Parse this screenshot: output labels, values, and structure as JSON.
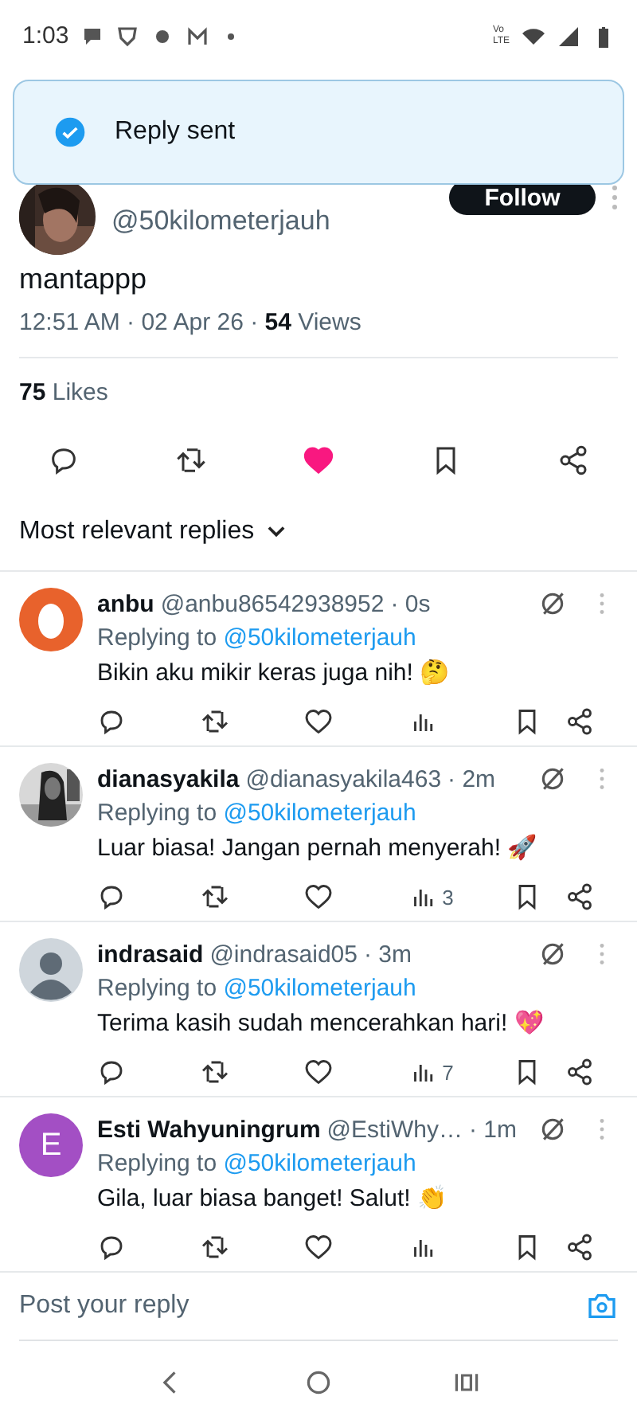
{
  "status_bar": {
    "time": "1:03",
    "volte_top": "Vo",
    "volte_bottom": "LTE"
  },
  "toast": {
    "message": "Reply sent"
  },
  "post": {
    "handle": "@50kilometerjauh",
    "follow_label": "Follow",
    "text": "mantappp",
    "meta": "12:51 AM · 02 Apr 26 · **54** Views",
    "likes": "**75** Likes",
    "liked": true,
    "bookmarked": false
  },
  "sort": {
    "label": "Most relevant replies"
  },
  "replies": [
    {
      "name": "anbu",
      "handle": "@anbu86542938952",
      "time": "· 0s",
      "replying_label": "Replying to",
      "replying_to": "@50kilometerjauh",
      "text": "Bikin aku mikir keras juga nih! 🤔",
      "liked": false,
      "avatar": {
        "kind": "egg",
        "color": "#e8622c"
      }
    },
    {
      "name": "dianasyakila",
      "handle": "@dianasyakila463",
      "time": "· 2m",
      "replying_label": "Replying to",
      "replying_to": "@50kilometerjauh",
      "text": "Luar biasa! Jangan pernah menyerah! 🚀",
      "views": "3",
      "liked": false
    },
    {
      "name": "indrasaid",
      "handle": "@indrasaid05",
      "time": "· 3m",
      "replying_label": "Replying to",
      "replying_to": "@50kilometerjauh",
      "text": "Terima kasih sudah mencerahkan hari! 💖",
      "views": "7",
      "liked": false,
      "avatar": {
        "kind": "silhouette",
        "color": "#cfd6dc"
      }
    },
    {
      "name": "Esti Wahyuningrum",
      "handle": "@EstiWhy…",
      "time": "· 1m",
      "replying_label": "Replying to",
      "replying_to": "@50kilometerjauh",
      "text": "Gila, luar biasa banget! Salut! 👏",
      "liked": false,
      "avatar": {
        "kind": "initial",
        "initial": "E",
        "color": "#a34fc4"
      }
    }
  ],
  "composer": {
    "placeholder": "Post your reply"
  }
}
